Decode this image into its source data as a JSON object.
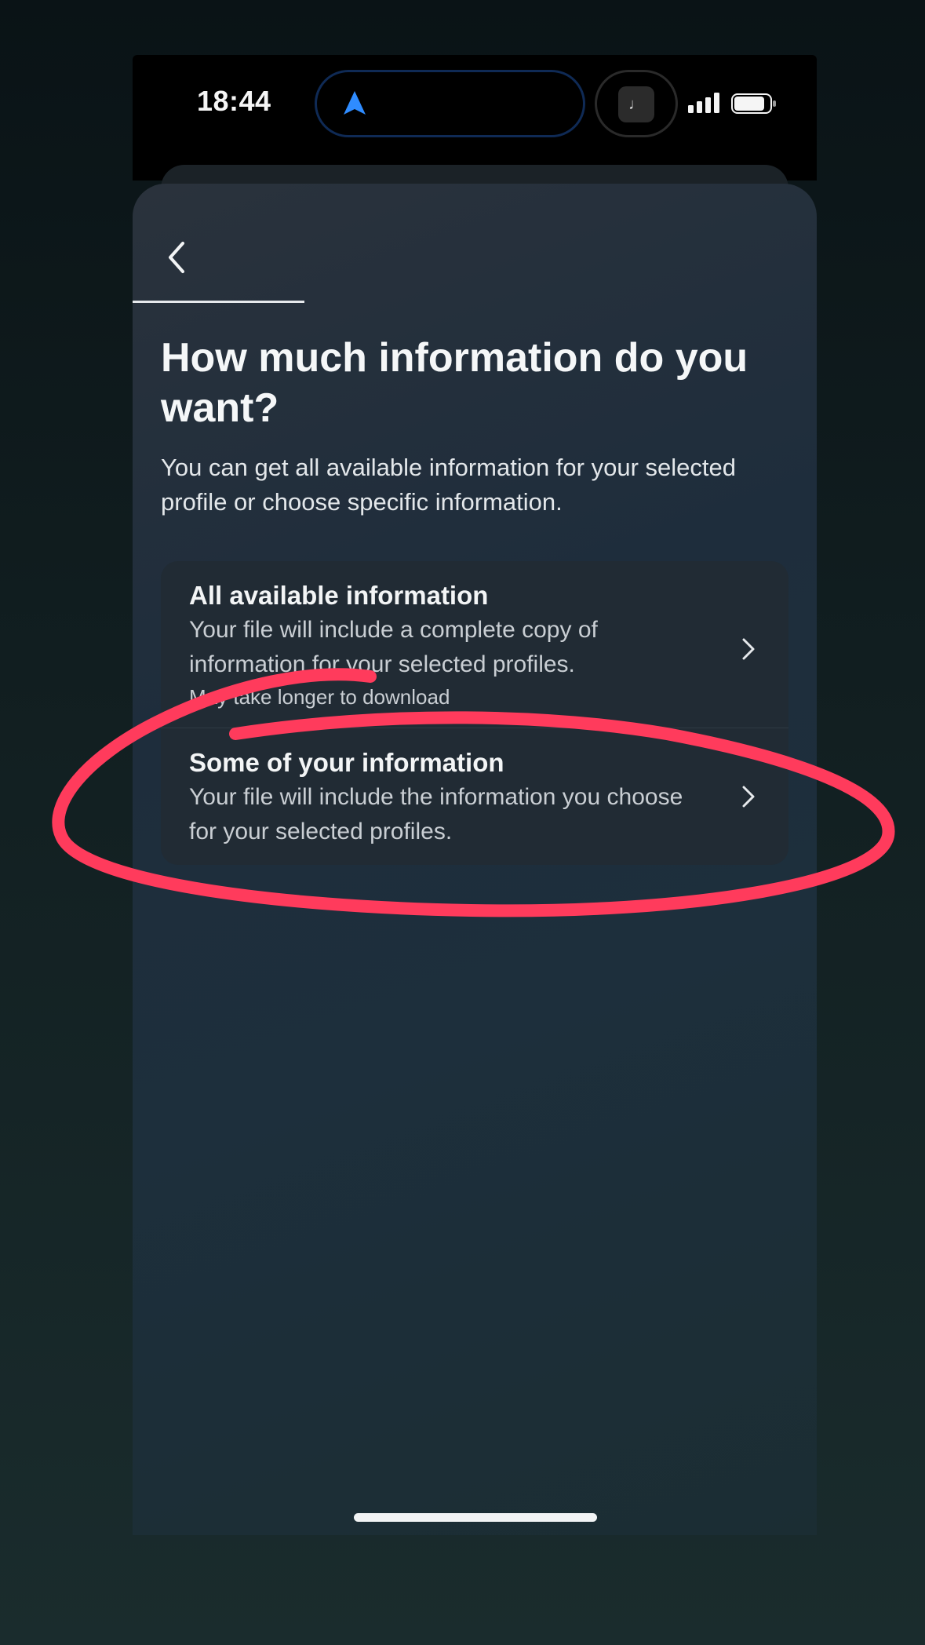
{
  "status_bar": {
    "time": "18:44"
  },
  "dynamic_island": {
    "camera_glyph": "♩"
  },
  "icons": {
    "navigation": "location-arrow-icon",
    "back": "chevron-left-icon",
    "option_chevron": "chevron-right-icon"
  },
  "page": {
    "title": "How much information do you want?",
    "subtitle": "You can get all available information for your selected profile or choose specific information."
  },
  "options": [
    {
      "title": "All available information",
      "description": "Your file will include a complete copy of information for your selected profiles.",
      "note": "May take longer to download"
    },
    {
      "title": "Some of your information",
      "description": "Your file will include the information you choose for your selected profiles."
    }
  ],
  "colors": {
    "accent_annotation": "#ff3b5c",
    "nav_arrow": "#2f8cff"
  }
}
